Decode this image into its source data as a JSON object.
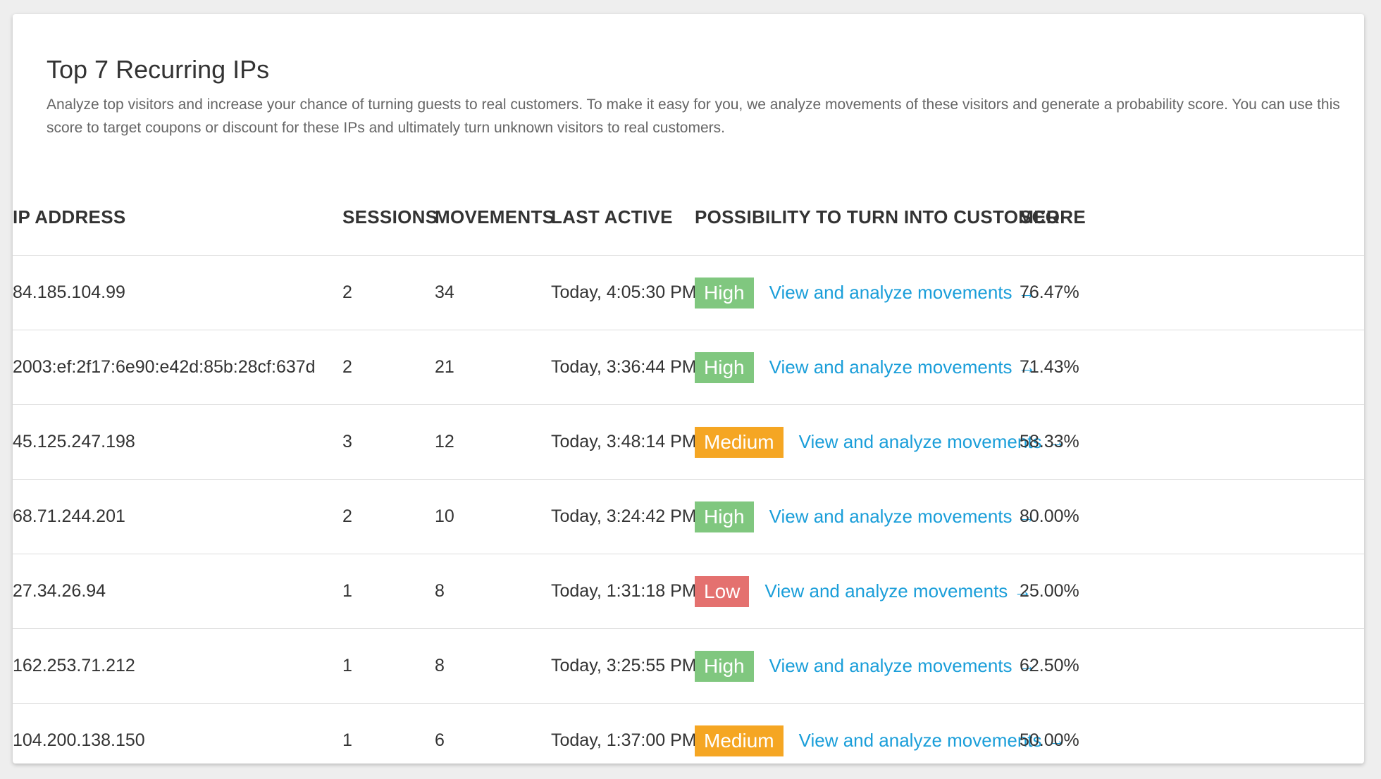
{
  "panel": {
    "title": "Top 7 Recurring IPs",
    "description": "Analyze top visitors and increase your chance of turning guests to real customers. To make it easy for you, we analyze movements of these visitors and generate a probability score. You can use this score to target coupons or discount for these IPs and ultimately turn unknown visitors to real customers."
  },
  "table": {
    "headers": {
      "ip": "IP ADDRESS",
      "sessions": "SESSIONS",
      "movements": "MOVEMENTS",
      "last_active": "LAST ACTIVE",
      "possibility": "POSSIBILITY TO TURN INTO CUSTOMER",
      "score": "SCORE"
    },
    "link_label": "View and analyze movements",
    "link_arrow": "→",
    "rows": [
      {
        "ip": "84.185.104.99",
        "sessions": "2",
        "movements": "34",
        "last_active": "Today, 4:05:30 PM",
        "possibility": "High",
        "score": "76.47%"
      },
      {
        "ip": "2003:ef:2f17:6e90:e42d:85b:28cf:637d",
        "sessions": "2",
        "movements": "21",
        "last_active": "Today, 3:36:44 PM",
        "possibility": "High",
        "score": "71.43%"
      },
      {
        "ip": "45.125.247.198",
        "sessions": "3",
        "movements": "12",
        "last_active": "Today, 3:48:14 PM",
        "possibility": "Medium",
        "score": "58.33%"
      },
      {
        "ip": "68.71.244.201",
        "sessions": "2",
        "movements": "10",
        "last_active": "Today, 3:24:42 PM",
        "possibility": "High",
        "score": "80.00%"
      },
      {
        "ip": "27.34.26.94",
        "sessions": "1",
        "movements": "8",
        "last_active": "Today, 1:31:18 PM",
        "possibility": "Low",
        "score": "25.00%"
      },
      {
        "ip": "162.253.71.212",
        "sessions": "1",
        "movements": "8",
        "last_active": "Today, 3:25:55 PM",
        "possibility": "High",
        "score": "62.50%"
      },
      {
        "ip": "104.200.138.150",
        "sessions": "1",
        "movements": "6",
        "last_active": "Today, 1:37:00 PM",
        "possibility": "Medium",
        "score": "50.00%"
      }
    ]
  },
  "colors": {
    "high": "#80c77f",
    "medium": "#f5a623",
    "low": "#e4716f",
    "link": "#1a9ed9"
  }
}
